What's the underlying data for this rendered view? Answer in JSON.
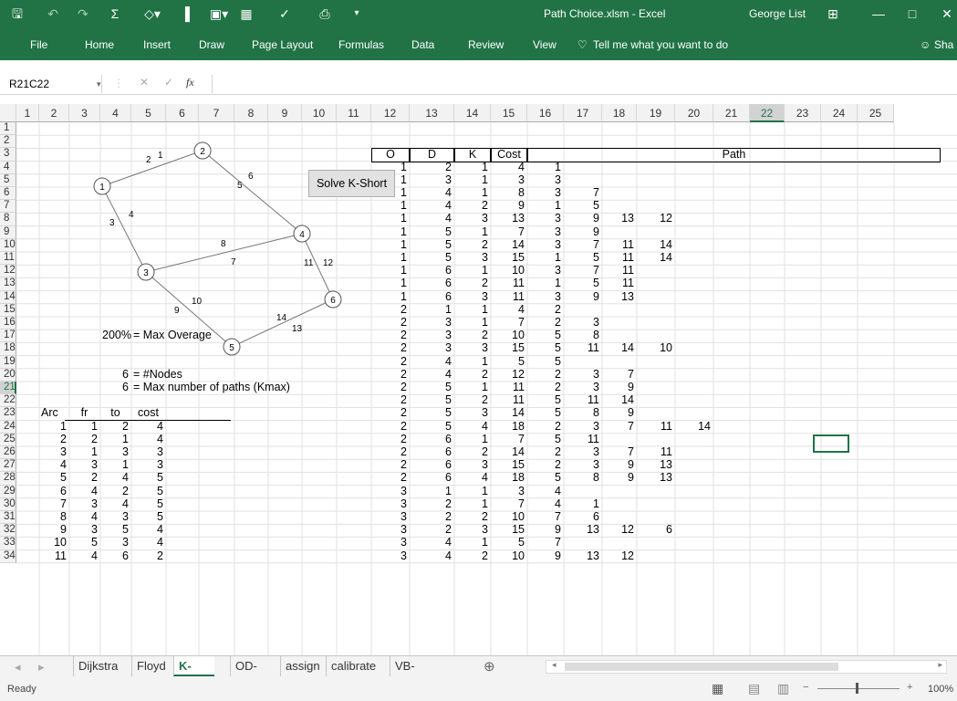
{
  "title": {
    "file": "Path Choice.xlsm - Excel",
    "user": "George List"
  },
  "ribbon": {
    "tabs": [
      "File",
      "Home",
      "Insert",
      "Draw",
      "Page Layout",
      "Formulas",
      "Data",
      "Review",
      "View"
    ],
    "tell_me": "Tell me what you want to do",
    "share": "Sha"
  },
  "formula_bar": {
    "name_box": "R21C22",
    "fx": "fx",
    "value": ""
  },
  "columns": [
    "1",
    "2",
    "3",
    "4",
    "5",
    "6",
    "7",
    "8",
    "9",
    "10",
    "11",
    "12",
    "13",
    "14",
    "15",
    "16",
    "17",
    "18",
    "19",
    "20",
    "21",
    "22",
    "23",
    "24",
    "25"
  ],
  "rows": [
    "1",
    "2",
    "3",
    "4",
    "5",
    "6",
    "7",
    "8",
    "9",
    "10",
    "11",
    "12",
    "13",
    "14",
    "15",
    "16",
    "17",
    "18",
    "19",
    "20",
    "21",
    "22",
    "23",
    "24",
    "25",
    "26",
    "27",
    "28",
    "29",
    "30",
    "31",
    "32",
    "33",
    "34"
  ],
  "button": {
    "label": "Solve K-Short"
  },
  "params": {
    "max_overage": "200%",
    "max_overage_label": "= Max Overage",
    "nodes": "6",
    "nodes_label": "= #Nodes",
    "kmax": "6",
    "kmax_label": "= Max number of paths (Kmax)"
  },
  "arc_table": {
    "headers": [
      "Arc",
      "fr",
      "to",
      "cost"
    ],
    "rows": [
      [
        "1",
        "1",
        "2",
        "4"
      ],
      [
        "2",
        "2",
        "1",
        "4"
      ],
      [
        "3",
        "1",
        "3",
        "3"
      ],
      [
        "4",
        "3",
        "1",
        "3"
      ],
      [
        "5",
        "2",
        "4",
        "5"
      ],
      [
        "6",
        "4",
        "2",
        "5"
      ],
      [
        "7",
        "3",
        "4",
        "5"
      ],
      [
        "8",
        "4",
        "3",
        "5"
      ],
      [
        "9",
        "3",
        "5",
        "4"
      ],
      [
        "10",
        "5",
        "3",
        "4"
      ],
      [
        "11",
        "4",
        "6",
        "2"
      ]
    ]
  },
  "path_table": {
    "headers": [
      "O",
      "D",
      "K",
      "Cost",
      "Path"
    ],
    "rows": [
      [
        "1",
        "2",
        "1",
        "4",
        "1",
        "",
        "",
        "",
        ""
      ],
      [
        "1",
        "3",
        "1",
        "3",
        "3",
        "",
        "",
        "",
        ""
      ],
      [
        "1",
        "4",
        "1",
        "8",
        "3",
        "7",
        "",
        "",
        ""
      ],
      [
        "1",
        "4",
        "2",
        "9",
        "1",
        "5",
        "",
        "",
        ""
      ],
      [
        "1",
        "4",
        "3",
        "13",
        "3",
        "9",
        "13",
        "12",
        ""
      ],
      [
        "1",
        "5",
        "1",
        "7",
        "3",
        "9",
        "",
        "",
        ""
      ],
      [
        "1",
        "5",
        "2",
        "14",
        "3",
        "7",
        "11",
        "14",
        ""
      ],
      [
        "1",
        "5",
        "3",
        "15",
        "1",
        "5",
        "11",
        "14",
        ""
      ],
      [
        "1",
        "6",
        "1",
        "10",
        "3",
        "7",
        "11",
        "",
        ""
      ],
      [
        "1",
        "6",
        "2",
        "11",
        "1",
        "5",
        "11",
        "",
        ""
      ],
      [
        "1",
        "6",
        "3",
        "11",
        "3",
        "9",
        "13",
        "",
        ""
      ],
      [
        "2",
        "1",
        "1",
        "4",
        "2",
        "",
        "",
        "",
        ""
      ],
      [
        "2",
        "3",
        "1",
        "7",
        "2",
        "3",
        "",
        "",
        ""
      ],
      [
        "2",
        "3",
        "2",
        "10",
        "5",
        "8",
        "",
        "",
        ""
      ],
      [
        "2",
        "3",
        "3",
        "15",
        "5",
        "11",
        "14",
        "10",
        ""
      ],
      [
        "2",
        "4",
        "1",
        "5",
        "5",
        "",
        "",
        "",
        ""
      ],
      [
        "2",
        "4",
        "2",
        "12",
        "2",
        "3",
        "7",
        "",
        ""
      ],
      [
        "2",
        "5",
        "1",
        "11",
        "2",
        "3",
        "9",
        "",
        ""
      ],
      [
        "2",
        "5",
        "2",
        "11",
        "5",
        "11",
        "14",
        "",
        ""
      ],
      [
        "2",
        "5",
        "3",
        "14",
        "5",
        "8",
        "9",
        "",
        ""
      ],
      [
        "2",
        "5",
        "4",
        "18",
        "2",
        "3",
        "7",
        "11",
        "14"
      ],
      [
        "2",
        "6",
        "1",
        "7",
        "5",
        "11",
        "",
        "",
        ""
      ],
      [
        "2",
        "6",
        "2",
        "14",
        "2",
        "3",
        "7",
        "11",
        ""
      ],
      [
        "2",
        "6",
        "3",
        "15",
        "2",
        "3",
        "9",
        "13",
        ""
      ],
      [
        "2",
        "6",
        "4",
        "18",
        "5",
        "8",
        "9",
        "13",
        ""
      ],
      [
        "3",
        "1",
        "1",
        "3",
        "4",
        "",
        "",
        "",
        ""
      ],
      [
        "3",
        "2",
        "1",
        "7",
        "4",
        "1",
        "",
        "",
        ""
      ],
      [
        "3",
        "2",
        "2",
        "10",
        "7",
        "6",
        "",
        "",
        ""
      ],
      [
        "3",
        "2",
        "3",
        "15",
        "9",
        "13",
        "12",
        "6",
        ""
      ],
      [
        "3",
        "4",
        "1",
        "5",
        "7",
        "",
        "",
        "",
        ""
      ],
      [
        "3",
        "4",
        "2",
        "10",
        "9",
        "13",
        "12",
        "",
        ""
      ]
    ]
  },
  "network": {
    "nodes": [
      "1",
      "2",
      "3",
      "4",
      "5",
      "6"
    ],
    "arc_labels": [
      "2",
      "1",
      "6",
      "5",
      "3",
      "4",
      "8",
      "7",
      "11",
      "12",
      "10",
      "9",
      "14",
      "13"
    ]
  },
  "sheets": [
    "Dijkstra",
    "Floyd",
    "K-Short",
    "OD-Est",
    "assign",
    "calibrate",
    "VB-Algo"
  ],
  "active_sheet": "K-Short",
  "status": {
    "ready": "Ready",
    "zoom": "100%"
  }
}
